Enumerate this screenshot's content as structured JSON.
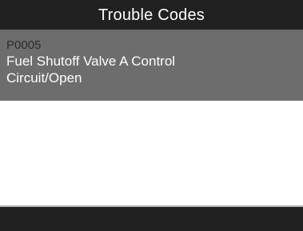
{
  "header": {
    "title": "Trouble Codes"
  },
  "codes": [
    {
      "code": "P0005",
      "description": "Fuel Shutoff Valve A Control Circuit/Open",
      "selected": true
    }
  ],
  "colors": {
    "header_bg": "#212121",
    "selected_row_bg": "#6d6d6d",
    "code_text": "#2b2b2b",
    "description_text": "#ffffff",
    "body_bg": "#ffffff",
    "footer_bg": "#212121"
  }
}
